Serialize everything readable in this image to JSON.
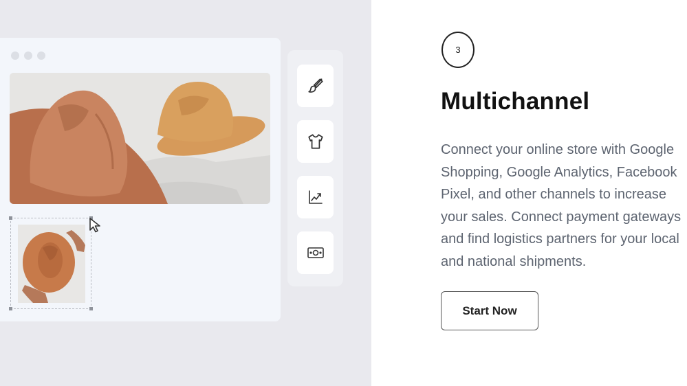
{
  "feature": {
    "step_number": "3",
    "title": "Multichannel",
    "description": "Connect your online store with Google Shopping, Google Analytics, Facebook Pixel, and other channels to increase your sales. Connect payment gateways and find logistics partners for your local and national shipments.",
    "cta_label": "Start Now"
  },
  "toolbar": {
    "items": [
      {
        "icon": "paintbrush-icon"
      },
      {
        "icon": "tshirt-icon"
      },
      {
        "icon": "line-chart-icon"
      },
      {
        "icon": "money-bill-icon"
      }
    ]
  },
  "colors": {
    "left_background": "#e9e9ee",
    "window_background": "#f3f6fb",
    "hat_dark": "#c47d55",
    "hat_light": "#d69a5a",
    "description_text": "#5d6470"
  }
}
